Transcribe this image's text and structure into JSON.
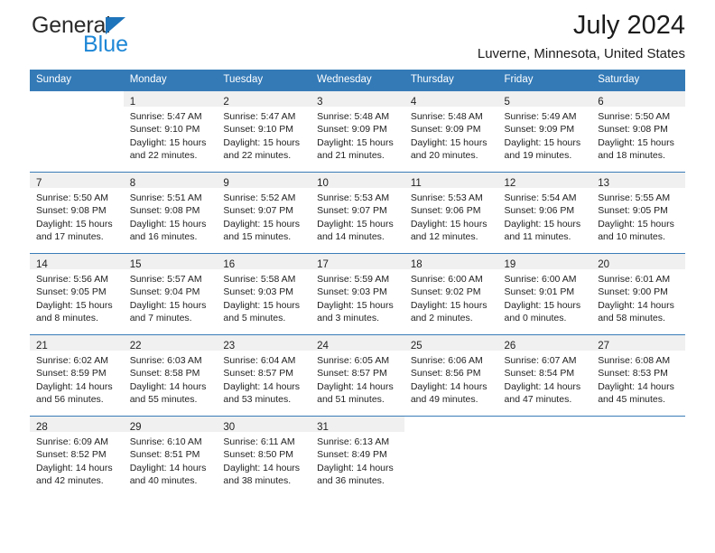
{
  "brand": {
    "name_top": "General",
    "name_bottom": "Blue",
    "accent_color": "#1e87d6",
    "triangle_color": "#1e74bb"
  },
  "header": {
    "title": "July 2024",
    "subtitle": "Luverne, Minnesota, United States"
  },
  "calendar": {
    "header_bg": "#337ab7",
    "weekday_headers": [
      "Sunday",
      "Monday",
      "Tuesday",
      "Wednesday",
      "Thursday",
      "Friday",
      "Saturday"
    ],
    "weeks": [
      [
        {
          "day": "",
          "sunrise": "",
          "sunset": "",
          "daylight_line1": "",
          "daylight_line2": ""
        },
        {
          "day": "1",
          "sunrise": "Sunrise: 5:47 AM",
          "sunset": "Sunset: 9:10 PM",
          "daylight_line1": "Daylight: 15 hours",
          "daylight_line2": "and 22 minutes."
        },
        {
          "day": "2",
          "sunrise": "Sunrise: 5:47 AM",
          "sunset": "Sunset: 9:10 PM",
          "daylight_line1": "Daylight: 15 hours",
          "daylight_line2": "and 22 minutes."
        },
        {
          "day": "3",
          "sunrise": "Sunrise: 5:48 AM",
          "sunset": "Sunset: 9:09 PM",
          "daylight_line1": "Daylight: 15 hours",
          "daylight_line2": "and 21 minutes."
        },
        {
          "day": "4",
          "sunrise": "Sunrise: 5:48 AM",
          "sunset": "Sunset: 9:09 PM",
          "daylight_line1": "Daylight: 15 hours",
          "daylight_line2": "and 20 minutes."
        },
        {
          "day": "5",
          "sunrise": "Sunrise: 5:49 AM",
          "sunset": "Sunset: 9:09 PM",
          "daylight_line1": "Daylight: 15 hours",
          "daylight_line2": "and 19 minutes."
        },
        {
          "day": "6",
          "sunrise": "Sunrise: 5:50 AM",
          "sunset": "Sunset: 9:08 PM",
          "daylight_line1": "Daylight: 15 hours",
          "daylight_line2": "and 18 minutes."
        }
      ],
      [
        {
          "day": "7",
          "sunrise": "Sunrise: 5:50 AM",
          "sunset": "Sunset: 9:08 PM",
          "daylight_line1": "Daylight: 15 hours",
          "daylight_line2": "and 17 minutes."
        },
        {
          "day": "8",
          "sunrise": "Sunrise: 5:51 AM",
          "sunset": "Sunset: 9:08 PM",
          "daylight_line1": "Daylight: 15 hours",
          "daylight_line2": "and 16 minutes."
        },
        {
          "day": "9",
          "sunrise": "Sunrise: 5:52 AM",
          "sunset": "Sunset: 9:07 PM",
          "daylight_line1": "Daylight: 15 hours",
          "daylight_line2": "and 15 minutes."
        },
        {
          "day": "10",
          "sunrise": "Sunrise: 5:53 AM",
          "sunset": "Sunset: 9:07 PM",
          "daylight_line1": "Daylight: 15 hours",
          "daylight_line2": "and 14 minutes."
        },
        {
          "day": "11",
          "sunrise": "Sunrise: 5:53 AM",
          "sunset": "Sunset: 9:06 PM",
          "daylight_line1": "Daylight: 15 hours",
          "daylight_line2": "and 12 minutes."
        },
        {
          "day": "12",
          "sunrise": "Sunrise: 5:54 AM",
          "sunset": "Sunset: 9:06 PM",
          "daylight_line1": "Daylight: 15 hours",
          "daylight_line2": "and 11 minutes."
        },
        {
          "day": "13",
          "sunrise": "Sunrise: 5:55 AM",
          "sunset": "Sunset: 9:05 PM",
          "daylight_line1": "Daylight: 15 hours",
          "daylight_line2": "and 10 minutes."
        }
      ],
      [
        {
          "day": "14",
          "sunrise": "Sunrise: 5:56 AM",
          "sunset": "Sunset: 9:05 PM",
          "daylight_line1": "Daylight: 15 hours",
          "daylight_line2": "and 8 minutes."
        },
        {
          "day": "15",
          "sunrise": "Sunrise: 5:57 AM",
          "sunset": "Sunset: 9:04 PM",
          "daylight_line1": "Daylight: 15 hours",
          "daylight_line2": "and 7 minutes."
        },
        {
          "day": "16",
          "sunrise": "Sunrise: 5:58 AM",
          "sunset": "Sunset: 9:03 PM",
          "daylight_line1": "Daylight: 15 hours",
          "daylight_line2": "and 5 minutes."
        },
        {
          "day": "17",
          "sunrise": "Sunrise: 5:59 AM",
          "sunset": "Sunset: 9:03 PM",
          "daylight_line1": "Daylight: 15 hours",
          "daylight_line2": "and 3 minutes."
        },
        {
          "day": "18",
          "sunrise": "Sunrise: 6:00 AM",
          "sunset": "Sunset: 9:02 PM",
          "daylight_line1": "Daylight: 15 hours",
          "daylight_line2": "and 2 minutes."
        },
        {
          "day": "19",
          "sunrise": "Sunrise: 6:00 AM",
          "sunset": "Sunset: 9:01 PM",
          "daylight_line1": "Daylight: 15 hours",
          "daylight_line2": "and 0 minutes."
        },
        {
          "day": "20",
          "sunrise": "Sunrise: 6:01 AM",
          "sunset": "Sunset: 9:00 PM",
          "daylight_line1": "Daylight: 14 hours",
          "daylight_line2": "and 58 minutes."
        }
      ],
      [
        {
          "day": "21",
          "sunrise": "Sunrise: 6:02 AM",
          "sunset": "Sunset: 8:59 PM",
          "daylight_line1": "Daylight: 14 hours",
          "daylight_line2": "and 56 minutes."
        },
        {
          "day": "22",
          "sunrise": "Sunrise: 6:03 AM",
          "sunset": "Sunset: 8:58 PM",
          "daylight_line1": "Daylight: 14 hours",
          "daylight_line2": "and 55 minutes."
        },
        {
          "day": "23",
          "sunrise": "Sunrise: 6:04 AM",
          "sunset": "Sunset: 8:57 PM",
          "daylight_line1": "Daylight: 14 hours",
          "daylight_line2": "and 53 minutes."
        },
        {
          "day": "24",
          "sunrise": "Sunrise: 6:05 AM",
          "sunset": "Sunset: 8:57 PM",
          "daylight_line1": "Daylight: 14 hours",
          "daylight_line2": "and 51 minutes."
        },
        {
          "day": "25",
          "sunrise": "Sunrise: 6:06 AM",
          "sunset": "Sunset: 8:56 PM",
          "daylight_line1": "Daylight: 14 hours",
          "daylight_line2": "and 49 minutes."
        },
        {
          "day": "26",
          "sunrise": "Sunrise: 6:07 AM",
          "sunset": "Sunset: 8:54 PM",
          "daylight_line1": "Daylight: 14 hours",
          "daylight_line2": "and 47 minutes."
        },
        {
          "day": "27",
          "sunrise": "Sunrise: 6:08 AM",
          "sunset": "Sunset: 8:53 PM",
          "daylight_line1": "Daylight: 14 hours",
          "daylight_line2": "and 45 minutes."
        }
      ],
      [
        {
          "day": "28",
          "sunrise": "Sunrise: 6:09 AM",
          "sunset": "Sunset: 8:52 PM",
          "daylight_line1": "Daylight: 14 hours",
          "daylight_line2": "and 42 minutes."
        },
        {
          "day": "29",
          "sunrise": "Sunrise: 6:10 AM",
          "sunset": "Sunset: 8:51 PM",
          "daylight_line1": "Daylight: 14 hours",
          "daylight_line2": "and 40 minutes."
        },
        {
          "day": "30",
          "sunrise": "Sunrise: 6:11 AM",
          "sunset": "Sunset: 8:50 PM",
          "daylight_line1": "Daylight: 14 hours",
          "daylight_line2": "and 38 minutes."
        },
        {
          "day": "31",
          "sunrise": "Sunrise: 6:13 AM",
          "sunset": "Sunset: 8:49 PM",
          "daylight_line1": "Daylight: 14 hours",
          "daylight_line2": "and 36 minutes."
        },
        {
          "day": "",
          "sunrise": "",
          "sunset": "",
          "daylight_line1": "",
          "daylight_line2": ""
        },
        {
          "day": "",
          "sunrise": "",
          "sunset": "",
          "daylight_line1": "",
          "daylight_line2": ""
        },
        {
          "day": "",
          "sunrise": "",
          "sunset": "",
          "daylight_line1": "",
          "daylight_line2": ""
        }
      ]
    ]
  }
}
